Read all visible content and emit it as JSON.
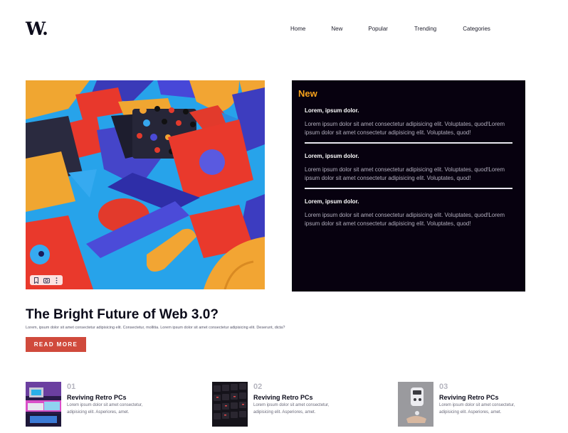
{
  "header": {
    "logo": "W.",
    "nav": [
      "Home",
      "New",
      "Popular",
      "Trending",
      "Categories"
    ]
  },
  "featured": {
    "image_tools": [
      "bookmark-icon",
      "lens-icon",
      "more-icon"
    ],
    "headline": "The Bright Future of Web 3.0?",
    "summary": "Lorem, ipsum dolor sit amet consectetur adipisicing elit. Consectetur, mollitia. Lorem ipsum dolor sit amet consectetur adipisicing elit. Deserunt, dicta?",
    "cta": "READ MORE"
  },
  "new_panel": {
    "title": "New",
    "items": [
      {
        "title": "Lorem, ipsum dolor.",
        "text": "Lorem ipsum dolor sit amet consectetur adipisicing elit. Voluptates, quod!Lorem ipsum dolor sit amet consectetur adipisicing elit. Voluptates, quod!"
      },
      {
        "title": "Lorem, ipsum dolor.",
        "text": "Lorem ipsum dolor sit amet consectetur adipisicing elit. Voluptates, quod!Lorem ipsum dolor sit amet consectetur adipisicing elit. Voluptates, quod!"
      },
      {
        "title": "Lorem, ipsum dolor.",
        "text": "Lorem ipsum dolor sit amet consectetur adipisicing elit. Voluptates, quod!Lorem ipsum dolor sit amet consectetur adipisicing elit. Voluptates, quod!"
      }
    ]
  },
  "cards": [
    {
      "num": "01",
      "title": "Reviving Retro PCs",
      "text": "Lorem ipsum dolor sit amet consectetur, adipisicing elit. Asperiores, amet."
    },
    {
      "num": "02",
      "title": "Reviving Retro PCs",
      "text": "Lorem ipsum dolor sit amet consectetur, adipisicing elit. Asperiores, amet."
    },
    {
      "num": "03",
      "title": "Reviving Retro PCs",
      "text": "Lorem ipsum dolor sit amet consectetur, adipisicing elit. Asperiores, amet."
    }
  ],
  "colors": {
    "accent": "#f7a21b",
    "cta": "#d04a3c",
    "panel": "#07010f"
  }
}
